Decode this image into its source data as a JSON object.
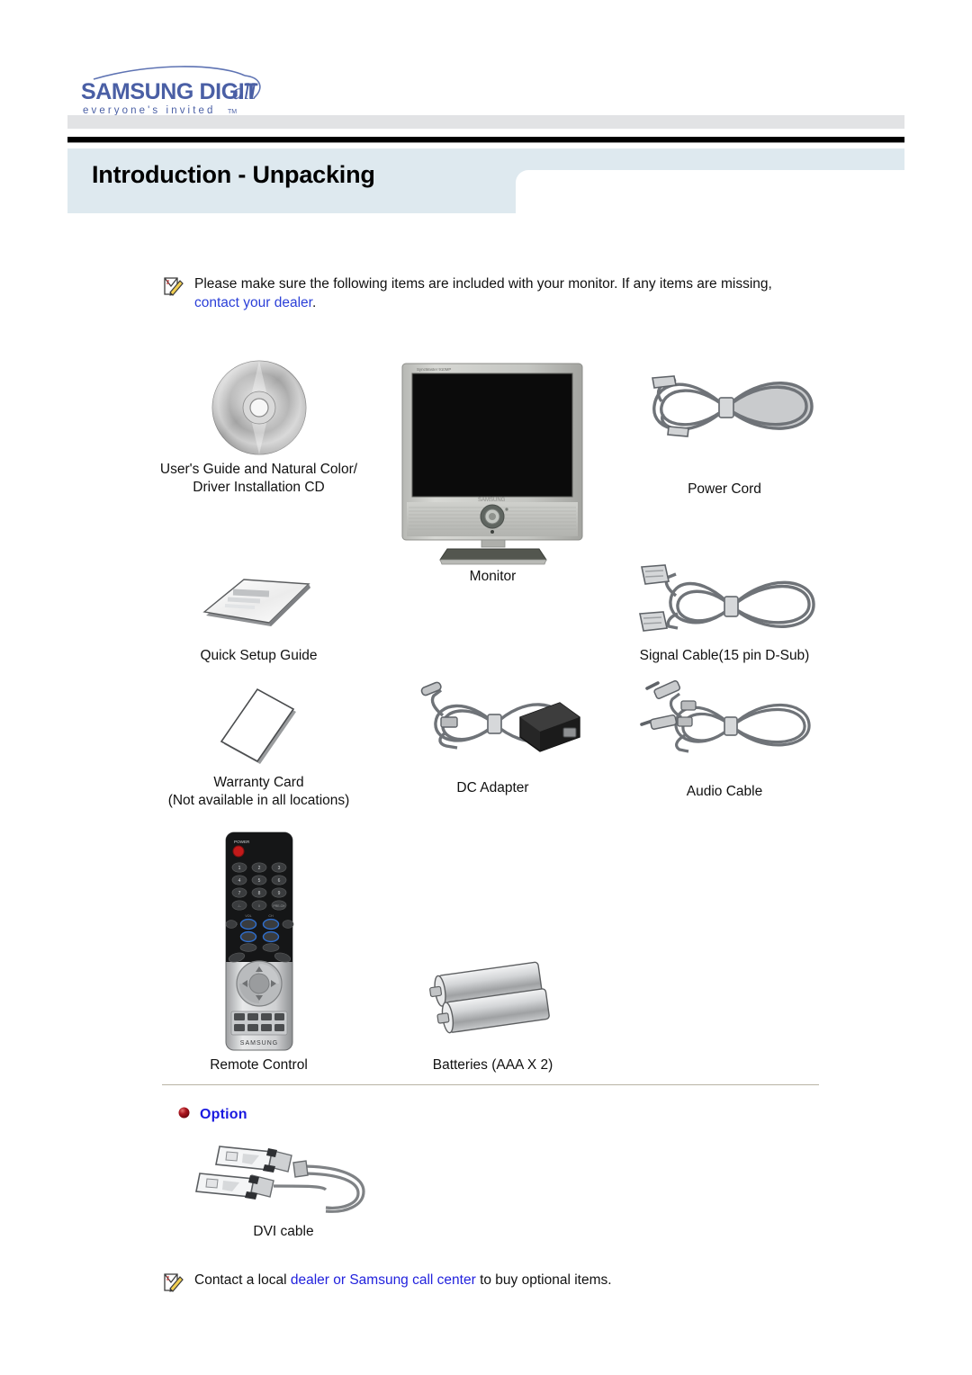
{
  "brand": {
    "logo_primary": "SAMSUNG DIGITall",
    "logo_tagline": "everyone's invited",
    "logo_tm": "TM",
    "logo_color": "#4a5fa5"
  },
  "header": {
    "page_title": "Introduction - Unpacking",
    "banner_color": "#dee9ef",
    "rule_color": "#000000"
  },
  "notes": {
    "top": {
      "icon": "note-pencil-icon",
      "text_before": "Please make sure the following items are included with your monitor. If any items are missing, ",
      "link_text": "contact your dealer",
      "text_after": "."
    },
    "bottom": {
      "icon": "note-pencil-icon",
      "text_before": "Contact a local ",
      "link_text": "dealer or Samsung call center",
      "text_after": " to buy optional items."
    },
    "link_color": "#2b3fd8"
  },
  "items": [
    {
      "id": "cd",
      "icon": "compact-disc-icon",
      "caption": "User's Guide and Natural Color/\nDriver Installation CD"
    },
    {
      "id": "monitor",
      "icon": "lcd-monitor-icon",
      "caption": "Monitor"
    },
    {
      "id": "power-cord",
      "icon": "power-cord-icon",
      "caption": "Power Cord"
    },
    {
      "id": "quick-setup-guide",
      "icon": "booklet-icon",
      "caption": "Quick Setup Guide"
    },
    {
      "id": "signal-cable",
      "icon": "d-sub-cable-icon",
      "caption": "Signal Cable(15 pin D-Sub)"
    },
    {
      "id": "warranty-card",
      "icon": "card-icon",
      "caption": "Warranty Card\n(Not available in all locations)"
    },
    {
      "id": "dc-adapter",
      "icon": "dc-adapter-icon",
      "caption": "DC Adapter"
    },
    {
      "id": "audio-cable",
      "icon": "audio-cable-icon",
      "caption": "Audio Cable"
    },
    {
      "id": "remote-control",
      "icon": "remote-control-icon",
      "caption": "Remote Control"
    },
    {
      "id": "batteries",
      "icon": "battery-icon",
      "caption": "Batteries (AAA X 2)"
    }
  ],
  "option_section": {
    "bullet": "red-sphere-bullet-icon",
    "label": "Option",
    "label_color": "#1a1ae0",
    "bullet_color": "#9c0b16",
    "item": {
      "id": "dvi-cable",
      "icon": "dvi-cable-icon",
      "caption": "DVI cable"
    }
  }
}
